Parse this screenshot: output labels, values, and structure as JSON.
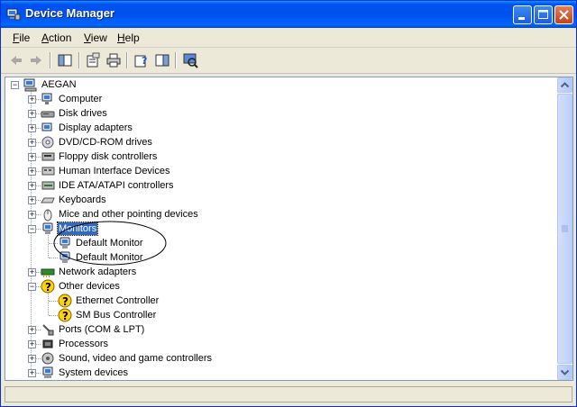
{
  "window": {
    "title": "Device Manager"
  },
  "menu": [
    {
      "label": "File",
      "key": "F"
    },
    {
      "label": "Action",
      "key": "A"
    },
    {
      "label": "View",
      "key": "V"
    },
    {
      "label": "Help",
      "key": "H"
    }
  ],
  "toolbar": {
    "icons": [
      "back-icon",
      "forward-icon",
      "show-hide-tree-icon",
      "properties-icon",
      "print-icon",
      "help-icon",
      "show-hide-action-pane-icon",
      "scan-hardware-icon"
    ]
  },
  "tree": {
    "root": {
      "label": "AEGAN"
    },
    "categories": [
      {
        "label": "Computer",
        "icon": "computer-icon"
      },
      {
        "label": "Disk drives",
        "icon": "disk-drive-icon"
      },
      {
        "label": "Display adapters",
        "icon": "display-adapter-icon"
      },
      {
        "label": "DVD/CD-ROM drives",
        "icon": "cdrom-icon"
      },
      {
        "label": "Floppy disk controllers",
        "icon": "floppy-controller-icon"
      },
      {
        "label": "Human Interface Devices",
        "icon": "hid-icon"
      },
      {
        "label": "IDE ATA/ATAPI controllers",
        "icon": "ide-controller-icon"
      },
      {
        "label": "Keyboards",
        "icon": "keyboard-icon"
      },
      {
        "label": "Mice and other pointing devices",
        "icon": "mouse-icon"
      },
      {
        "label": "Monitors",
        "icon": "monitor-icon",
        "expanded": true,
        "selected": true,
        "children": [
          {
            "label": "Default Monitor"
          },
          {
            "label": "Default Monitor"
          }
        ]
      },
      {
        "label": "Network adapters",
        "icon": "network-adapter-icon"
      },
      {
        "label": "Other devices",
        "icon": "unknown-device-icon",
        "expanded": true,
        "children": [
          {
            "label": "Ethernet Controller"
          },
          {
            "label": "SM Bus Controller"
          }
        ]
      },
      {
        "label": "Ports (COM & LPT)",
        "icon": "port-icon"
      },
      {
        "label": "Processors",
        "icon": "processor-icon"
      },
      {
        "label": "Sound, video and game controllers",
        "icon": "sound-icon"
      },
      {
        "label": "System devices",
        "icon": "system-device-icon"
      }
    ]
  },
  "colors": {
    "selection": "#316ac5",
    "titlebar": "#0053ee",
    "annotation": "#000000"
  }
}
